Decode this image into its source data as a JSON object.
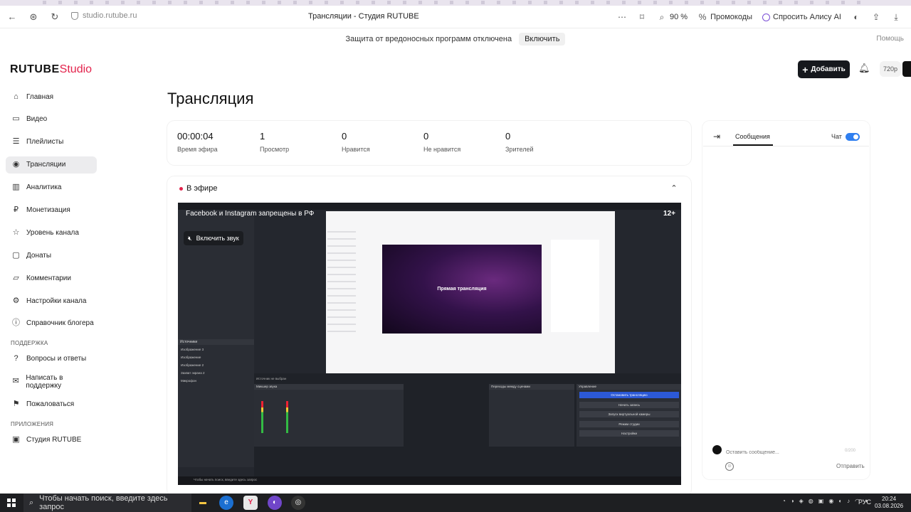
{
  "browser": {
    "url": "studio.rutube.ru",
    "page_title": "Трансляции - Студия RUTUBE",
    "zoom": "90 %",
    "promo": "Промокоды",
    "alice": "Спросить Алису AI"
  },
  "warning_bar": {
    "text": "Защита от вредоносных программ отключена",
    "enable_label": "Включить",
    "help": "Помощь"
  },
  "header": {
    "logo_main": "RUTUBE",
    "logo_studio": "Studio",
    "add_label": "Добавить",
    "quality": "720p"
  },
  "sidebar": {
    "items": [
      {
        "label": "Главная",
        "icon": "home-icon",
        "glyph": "⌂"
      },
      {
        "label": "Видео",
        "icon": "video-icon",
        "glyph": "▭"
      },
      {
        "label": "Плейлисты",
        "icon": "playlist-icon",
        "glyph": "☰"
      },
      {
        "label": "Трансляции",
        "icon": "broadcast-icon",
        "glyph": "◉"
      },
      {
        "label": "Аналитика",
        "icon": "analytics-icon",
        "glyph": "▥"
      },
      {
        "label": "Монетизация",
        "icon": "money-icon",
        "glyph": "₽"
      },
      {
        "label": "Уровень канала",
        "icon": "star-icon",
        "glyph": "☆"
      },
      {
        "label": "Донаты",
        "icon": "donate-icon",
        "glyph": "▢"
      },
      {
        "label": "Комментарии",
        "icon": "comments-icon",
        "glyph": "▱"
      },
      {
        "label": "Настройки канала",
        "icon": "settings-icon",
        "glyph": "⚙"
      },
      {
        "label": "Справочник блогера",
        "icon": "guide-icon",
        "glyph": "ⓘ"
      }
    ],
    "support_title": "ПОДДЕРЖКА",
    "support_items": [
      {
        "label": "Вопросы и ответы",
        "icon": "faq-icon",
        "glyph": "?"
      },
      {
        "label": "Написать в поддержку",
        "icon": "mail-icon",
        "glyph": "✉"
      },
      {
        "label": "Пожаловаться",
        "icon": "flag-icon",
        "glyph": "⚑"
      }
    ],
    "apps_title": "ПРИЛОЖЕНИЯ",
    "apps_items": [
      {
        "label": "Студия RUTUBE",
        "icon": "app-icon",
        "glyph": "▣"
      }
    ]
  },
  "main": {
    "title": "Трансляция",
    "stats": [
      {
        "value": "00:00:04",
        "label": "Время эфира"
      },
      {
        "value": "1",
        "label": "Просмотр"
      },
      {
        "value": "0",
        "label": "Нравится"
      },
      {
        "value": "0",
        "label": "Не нравится"
      },
      {
        "value": "0",
        "label": "Зрителей"
      }
    ],
    "live_label": "В эфире",
    "player": {
      "warning": "Facebook и Instagram запрещены в РФ",
      "age": "12+",
      "sound": "Включить звук",
      "preview_text": "Прямая трансляция",
      "sources_title": "Источники",
      "sources": [
        "Изображение 3",
        "Изображение",
        "Изображение 2",
        "Захват экрана 2",
        "Микрофон"
      ],
      "no_source": "Источник не выбран",
      "mixer_title": "Микшер звука",
      "transitions_title": "Переходы между сценами",
      "controls_title": "Управление",
      "controls": [
        "Остановить трансляцию",
        "Начать запись",
        "Запуск виртуальной камеры",
        "Режим студии",
        "Настройки"
      ],
      "taskbar_search": "Чтобы начать поиск, введите здесь запрос"
    }
  },
  "chat": {
    "tab": "Сообщения",
    "toggle_label": "Чат",
    "input_placeholder": "Оставить сообщение...",
    "counter": "0/200",
    "send": "Отправить"
  },
  "taskbar": {
    "search_placeholder": "Чтобы начать поиск, введите здесь запрос",
    "lang": "РУС",
    "time": "20:24",
    "date": "03.08.2026"
  }
}
